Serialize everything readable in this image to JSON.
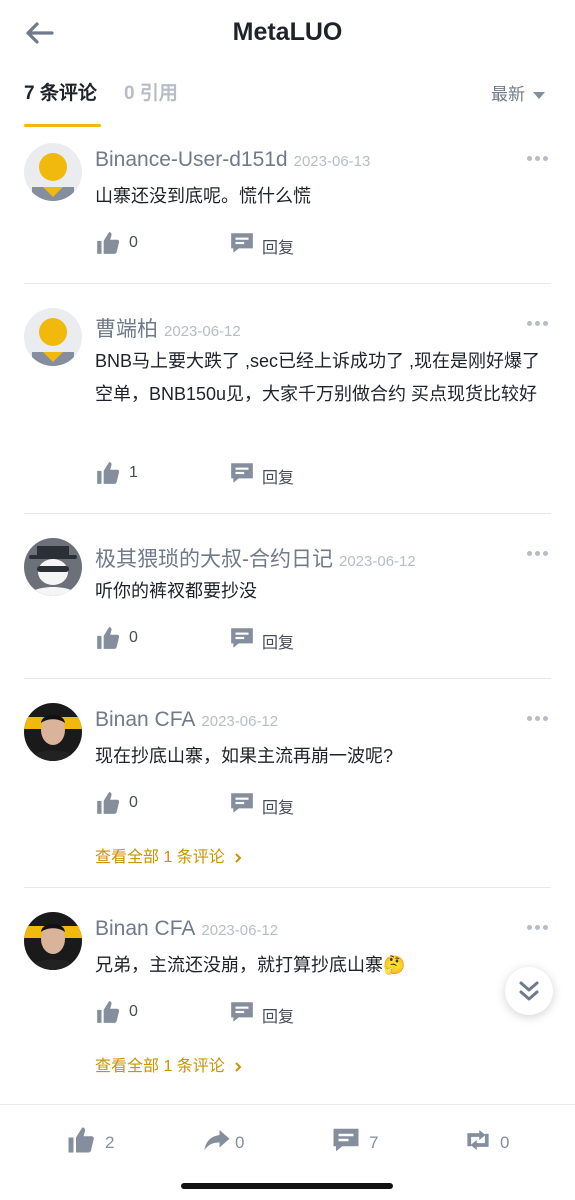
{
  "header": {
    "title": "MetaLUO"
  },
  "tabs": [
    {
      "label": "7 条评论"
    },
    {
      "label": "0 引用"
    }
  ],
  "sort": {
    "label": "最新"
  },
  "comments": [
    {
      "author": "Binance-User-d151d",
      "date": "2023-06-13",
      "text": "山寨还没到底呢。慌什么慌",
      "likes": "0",
      "reply_label": "回复",
      "view_all": "",
      "avatar": "default-yellow-avatar"
    },
    {
      "author": "曹端柏",
      "date": "2023-06-12",
      "text": "BNB马上要大跌了 ,sec已经上诉成功了 ,现在是刚好爆了空单，BNB150u见，大家千万别做合约 买点现货比较好",
      "likes": "1",
      "reply_label": "回复",
      "view_all": "",
      "avatar": "default-yellow-avatar"
    },
    {
      "author": "极其猥琐的大叔-合约日记",
      "date": "2023-06-12",
      "text": "听你的裤衩都要抄没",
      "likes": "0",
      "reply_label": "回复",
      "view_all": "",
      "avatar": "masked-hat-avatar"
    },
    {
      "author": "Binan CFA",
      "date": "2023-06-12",
      "text": "现在抄底山寨，如果主流再崩一波呢?",
      "likes": "0",
      "reply_label": "回复",
      "view_all": "查看全部 1 条评论",
      "avatar": "photo-avatar"
    },
    {
      "author": "Binan CFA",
      "date": "2023-06-12",
      "text": "兄弟，主流还没崩，就打算抄底山寨🤔",
      "likes": "0",
      "reply_label": "回复",
      "view_all": "查看全部 1 条评论",
      "avatar": "photo-avatar"
    }
  ],
  "bottom_bar": {
    "likes": "2",
    "shares": "0",
    "comments": "7",
    "reposts": "0"
  },
  "colors": {
    "accent": "#f0b90b",
    "link": "#c99400",
    "muted": "#707a8a",
    "text": "#1e2329"
  }
}
